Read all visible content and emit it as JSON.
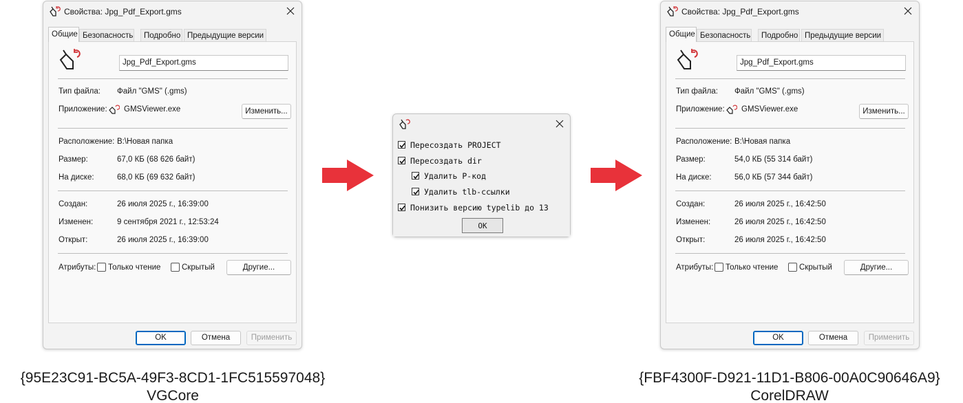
{
  "left_dialog": {
    "title": "Свойства: Jpg_Pdf_Export.gms",
    "tabs": [
      "Общие",
      "Безопасность",
      "Подробно",
      "Предыдущие версии"
    ],
    "file_name": "Jpg_Pdf_Export.gms",
    "file_type_label": "Тип файла:",
    "file_type_value": "Файл \"GMS\" (.gms)",
    "app_label": "Приложение:",
    "app_value": "GMSViewer.exe",
    "change_button": "Изменить...",
    "location_label": "Расположение:",
    "location_value": "B:\\Новая папка",
    "size_label": "Размер:",
    "size_value": "67,0 КБ (68 626 байт)",
    "disk_label": "На диске:",
    "disk_value": "68,0 КБ (69 632 байт)",
    "created_label": "Создан:",
    "created_value": "26 июля 2025 г., 16:39:00",
    "modified_label": "Изменен:",
    "modified_value": "9 сентября 2021 г., 12:53:24",
    "opened_label": "Открыт:",
    "opened_value": "26 июля 2025 г., 16:39:00",
    "attributes_label": "Атрибуты:",
    "readonly_label": "Только чтение",
    "hidden_label": "Скрытый",
    "other_button": "Другие...",
    "ok_button": "OK",
    "cancel_button": "Отмена",
    "apply_button": "Применить"
  },
  "right_dialog": {
    "title": "Свойства: Jpg_Pdf_Export.gms",
    "tabs": [
      "Общие",
      "Безопасность",
      "Подробно",
      "Предыдущие версии"
    ],
    "file_name": "Jpg_Pdf_Export.gms",
    "file_type_label": "Тип файла:",
    "file_type_value": "Файл \"GMS\" (.gms)",
    "app_label": "Приложение:",
    "app_value": "GMSViewer.exe",
    "change_button": "Изменить...",
    "location_label": "Расположение:",
    "location_value": "B:\\Новая папка",
    "size_label": "Размер:",
    "size_value": "54,0 КБ (55 314 байт)",
    "disk_label": "На диске:",
    "disk_value": "56,0 КБ (57 344 байт)",
    "created_label": "Создан:",
    "created_value": "26 июля 2025 г., 16:42:50",
    "modified_label": "Изменен:",
    "modified_value": "26 июля 2025 г., 16:42:50",
    "opened_label": "Открыт:",
    "opened_value": "26 июля 2025 г., 16:42:50",
    "attributes_label": "Атрибуты:",
    "readonly_label": "Только чтение",
    "hidden_label": "Скрытый",
    "other_button": "Другие...",
    "ok_button": "OK",
    "cancel_button": "Отмена",
    "apply_button": "Применить"
  },
  "options_dialog": {
    "options": [
      {
        "label": "Пересоздать PROJECT",
        "checked": true,
        "indent": false
      },
      {
        "label": "Пересоздать dir",
        "checked": true,
        "indent": false
      },
      {
        "label": "Удалить P-код",
        "checked": true,
        "indent": true
      },
      {
        "label": "Удалить tlb-ссылки",
        "checked": true,
        "indent": true
      },
      {
        "label": "Понизить версию typelib до 13",
        "checked": true,
        "indent": false
      }
    ],
    "ok_button": "OK"
  },
  "captions": {
    "left_guid": "{95E23C91-BC5A-49F3-8CD1-1FC515597048}",
    "left_name": "VGCore",
    "right_guid": "{FBF4300F-D921-11D1-B806-00A0C90646A9}",
    "right_name": "CorelDRAW"
  },
  "colors": {
    "arrow": "#e8323a",
    "accent": "#0067c0",
    "icon_red": "#d13438"
  }
}
